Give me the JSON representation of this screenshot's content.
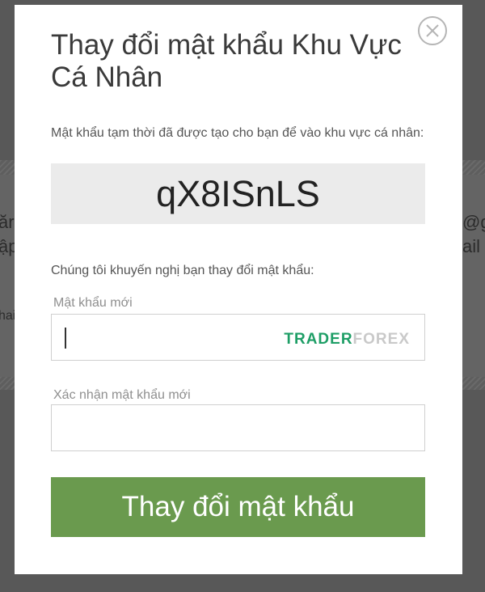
{
  "background": {
    "fragments": [
      "ăr",
      "ập",
      "hai",
      "@g",
      "ail"
    ]
  },
  "modal": {
    "title": "Thay đổi mật khẩu Khu Vực Cá Nhân",
    "info_text": "Mật khẩu tạm thời đã được tạo cho bạn để vào khu vực cá nhân:",
    "temp_password": "qX8ISnLS",
    "recommend_text": "Chúng tôi khuyến nghị bạn thay đổi mật khẩu:",
    "new_password_label": "Mật khẩu mới",
    "new_password_value": "",
    "confirm_password_label": "Xác nhận mật khẩu mới",
    "confirm_password_value": "",
    "watermark_part1": "TRADER",
    "watermark_part2": "FOREX",
    "submit_label": "Thay đổi mật khẩu"
  },
  "colors": {
    "submit_button": "#6a9a4e",
    "watermark_green": "#1e9e66",
    "overlay": "#585858"
  }
}
